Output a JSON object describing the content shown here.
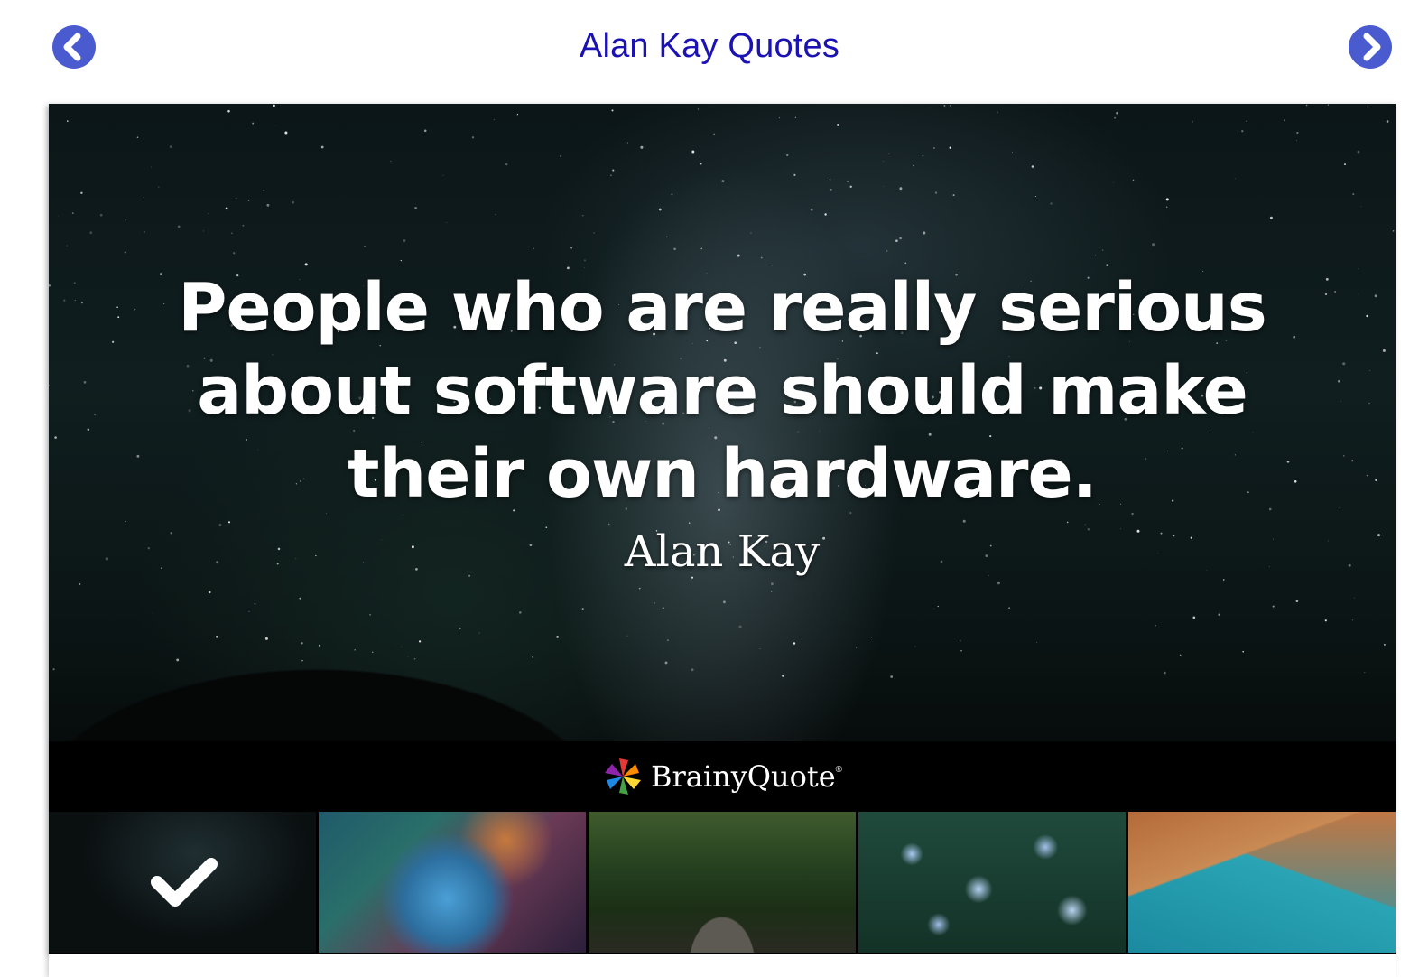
{
  "header": {
    "title": "Alan Kay Quotes",
    "prev_icon": "chevron-left-circle-icon",
    "next_icon": "chevron-right-circle-icon",
    "title_color": "#1a12b5",
    "nav_color": "#4a5bd0"
  },
  "quote": {
    "text": "People who are really serious about software should make their own hardware.",
    "author": "Alan Kay"
  },
  "brand": {
    "name": "BrainyQuote",
    "mark": "®"
  },
  "thumbnails": [
    {
      "label": "starry night sky background",
      "selected": true,
      "icon": "checkmark-icon"
    },
    {
      "label": "nebula background",
      "selected": false
    },
    {
      "label": "forest bridge background",
      "selected": false
    },
    {
      "label": "blue flowers background",
      "selected": false
    },
    {
      "label": "coastal cliffs background",
      "selected": false
    }
  ]
}
